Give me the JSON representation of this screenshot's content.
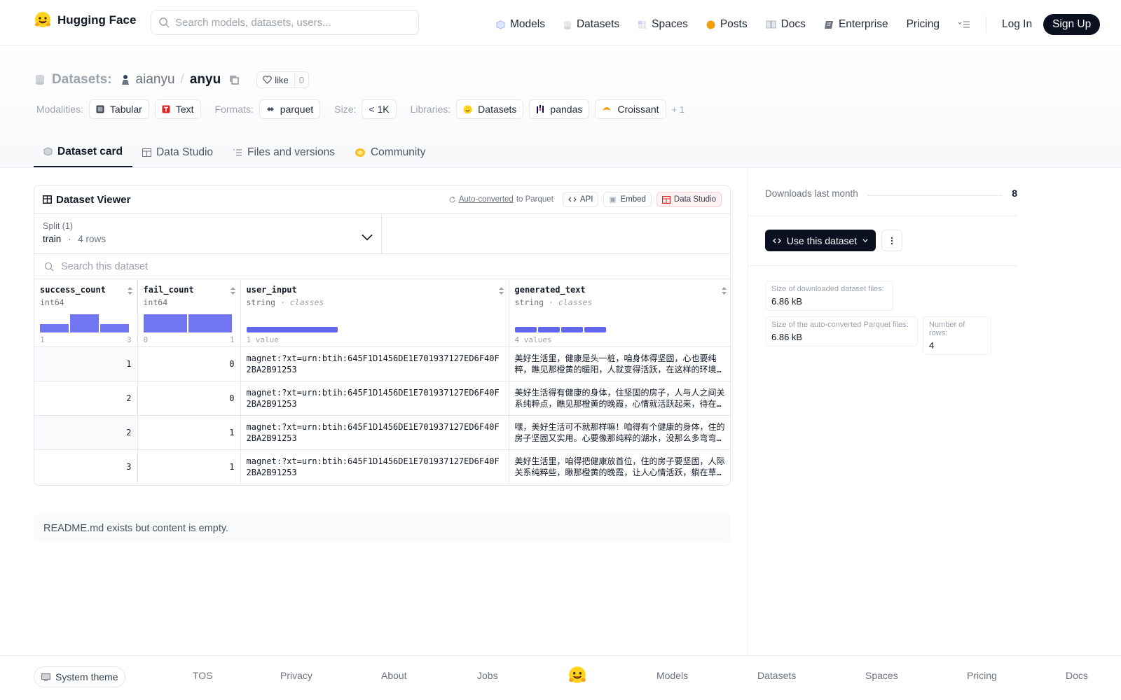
{
  "nav": {
    "brand": "Hugging Face",
    "search_placeholder": "Search models, datasets, users...",
    "links": [
      "Models",
      "Datasets",
      "Spaces",
      "Posts",
      "Docs",
      "Enterprise",
      "Pricing"
    ],
    "login": "Log In",
    "signup": "Sign Up"
  },
  "header": {
    "datasets_label": "Datasets:",
    "owner": "aianyu",
    "separator": "/",
    "repo": "anyu",
    "like_label": "like",
    "like_count": "0"
  },
  "tags": {
    "modalities_label": "Modalities:",
    "modalities": [
      "Tabular",
      "Text"
    ],
    "formats_label": "Formats:",
    "formats": [
      "parquet"
    ],
    "size_label": "Size:",
    "size": "< 1K",
    "libraries_label": "Libraries:",
    "libraries": [
      "Datasets",
      "pandas",
      "Croissant"
    ],
    "more": "+ 1"
  },
  "tabs": [
    "Dataset card",
    "Data Studio",
    "Files and versions",
    "Community"
  ],
  "viewer": {
    "title": "Dataset Viewer",
    "auto_converted": "Auto-converted",
    "to_parquet": "to Parquet",
    "api": "API",
    "embed": "Embed",
    "data_studio": "Data Studio",
    "split_label": "Split (1)",
    "split_value": "train",
    "split_dot": "·",
    "split_rows": "4 rows",
    "search_placeholder": "Search this dataset",
    "columns": [
      {
        "name": "success_count",
        "type": "int64",
        "type_suffix": "",
        "min": "1",
        "max": "3",
        "hist": [
          0.45,
          1.0,
          0.45
        ]
      },
      {
        "name": "fail_count",
        "type": "int64",
        "type_suffix": "",
        "min": "0",
        "max": "1",
        "hist": [
          1.0,
          1.0
        ]
      },
      {
        "name": "user_input",
        "type": "string",
        "type_suffix": "classes",
        "summary": "1 value",
        "segments": [
          1.0
        ]
      },
      {
        "name": "generated_text",
        "type": "string",
        "type_suffix": "classes",
        "summary": "4 values",
        "segments": [
          0.25,
          0.25,
          0.25,
          0.25
        ]
      }
    ],
    "type_dot": "·",
    "rows": [
      [
        "1",
        "0",
        "magnet:?xt=urn:btih:645F1D1456DE1E701937127ED6F40F2BA2B91253",
        "美好生活里，健康是头一桩，咱身体得坚固，心也要纯粹，瞧见那橙黄的暖阳，人就变得活跃，在这样的环境里过日子，真是美哉。"
      ],
      [
        "2",
        "0",
        "magnet:?xt=urn:btih:645F1D1456DE1E701937127ED6F40F2BA2B91253",
        "美好生活得有健康的身体，住坚固的房子，人与人之间关系纯粹点，瞧见那橙黄的晚霞，心情就活跃起来，待在这样的地方真是好。"
      ],
      [
        "2",
        "1",
        "magnet:?xt=urn:btih:645F1D1456DE1E701937127ED6F40F2BA2B91253",
        "嘿，美好生活可不就那样嘛！咱得有个健康的身体，住的房子坚固又实用。心要像那纯粹的湖水，没那么多弯弯绕绕。"
      ],
      [
        "3",
        "1",
        "magnet:?xt=urn:btih:645F1D1456DE1E701937127ED6F40F2BA2B91253",
        "美好生活里，咱得把健康放首位，住的房子要坚固，人际关系纯粹些，瞅那橙黄的晚霞，让人心情活跃，躺在草地上真舒坦。"
      ]
    ]
  },
  "readme_note": "README.md exists but content is empty.",
  "sidebar": {
    "downloads_label": "Downloads last month",
    "downloads_value": "8",
    "use_dataset": "Use this dataset",
    "stats": [
      {
        "label": "Size of downloaded dataset files:",
        "value": "6.86 kB"
      },
      {
        "label": "Size of the auto-converted Parquet files:",
        "value": "6.86 kB"
      },
      {
        "label": "Number of rows:",
        "value": "4"
      }
    ]
  },
  "footer": {
    "theme": "System theme",
    "links": [
      "TOS",
      "Privacy",
      "About",
      "Jobs",
      "Models",
      "Datasets",
      "Spaces",
      "Pricing",
      "Docs"
    ]
  },
  "colors": {
    "accent_bar": "#6366f1",
    "brand_yellow": "#ffd21e",
    "dark_button": "#0b1020"
  }
}
